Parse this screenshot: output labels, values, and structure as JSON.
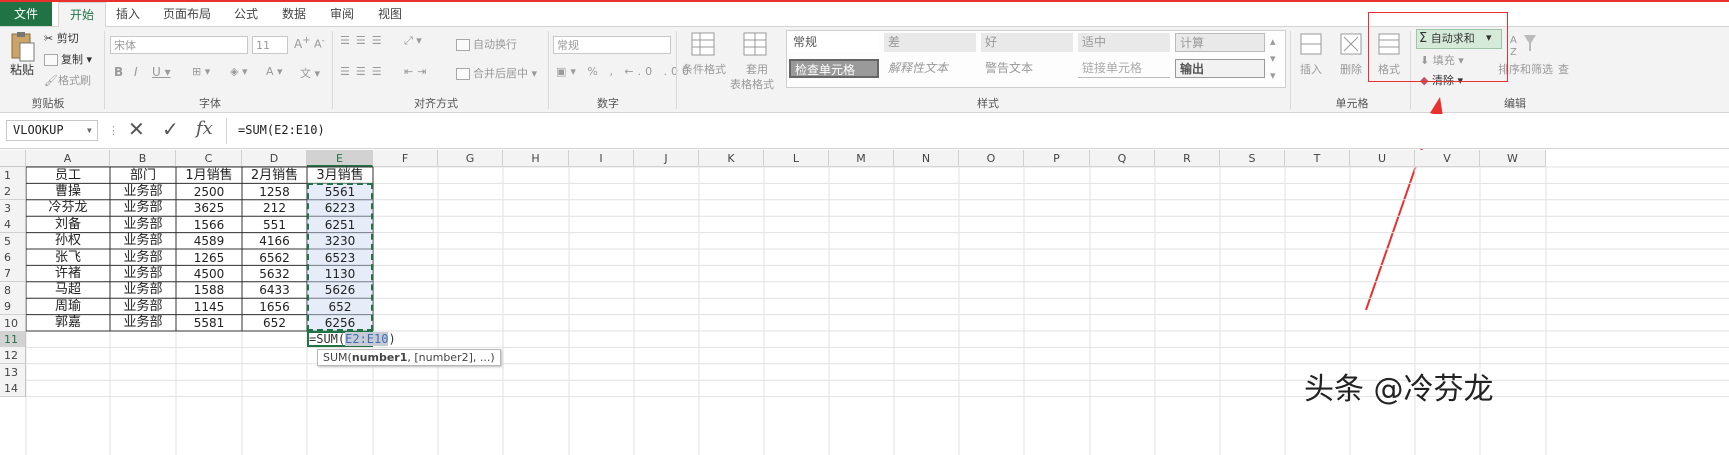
{
  "tabs": {
    "file": "文件",
    "home": "开始",
    "insert": "插入",
    "layout": "页面布局",
    "formulas": "公式",
    "data": "数据",
    "review": "审阅",
    "view": "视图"
  },
  "clipboard": {
    "paste": "粘贴",
    "cut": "剪切",
    "copy": "复制",
    "painter": "格式刷",
    "label": "剪贴板"
  },
  "font": {
    "name": "宋体",
    "size": "11",
    "label": "字体"
  },
  "align": {
    "wrap": "自动换行",
    "merge": "合并后居中",
    "label": "对齐方式"
  },
  "number": {
    "format": "常规",
    "label": "数字"
  },
  "styles": {
    "cond": "条件格式",
    "table1": "套用",
    "table2": "表格格式",
    "label": "样式",
    "cells": [
      "常规",
      "差",
      "好",
      "适中",
      "计算",
      "检查单元格",
      "解释性文本",
      "警告文本",
      "链接单元格",
      "输出"
    ]
  },
  "cells_group": {
    "insert": "插入",
    "delete": "删除",
    "format": "格式",
    "label": "单元格"
  },
  "editing": {
    "autosum": "自动求和",
    "fill": "填充",
    "clear": "清除",
    "sort": "排序和筛选",
    "find": "查",
    "label": "编辑"
  },
  "formula_bar": {
    "namebox": "VLOOKUP",
    "formula": "=SUM(E2:E10)"
  },
  "columns": [
    "A",
    "B",
    "C",
    "D",
    "E",
    "F",
    "G",
    "H",
    "I",
    "J",
    "K",
    "L",
    "M",
    "N",
    "O",
    "P",
    "Q",
    "R",
    "S",
    "T",
    "U",
    "V",
    "W"
  ],
  "rows": [
    "1",
    "2",
    "3",
    "4",
    "5",
    "6",
    "7",
    "8",
    "9",
    "10",
    "11",
    "12",
    "13",
    "14"
  ],
  "table": {
    "headers": [
      "员工",
      "部门",
      "1月销售",
      "2月销售",
      "3月销售"
    ],
    "data": [
      [
        "曹操",
        "业务部",
        "2500",
        "1258",
        "5561"
      ],
      [
        "冷芬龙",
        "业务部",
        "3625",
        "212",
        "6223"
      ],
      [
        "刘备",
        "业务部",
        "1566",
        "551",
        "6251"
      ],
      [
        "孙权",
        "业务部",
        "4589",
        "4166",
        "3230"
      ],
      [
        "张飞",
        "业务部",
        "1265",
        "6562",
        "6523"
      ],
      [
        "许褚",
        "业务部",
        "4500",
        "5632",
        "1130"
      ],
      [
        "马超",
        "业务部",
        "1588",
        "6433",
        "5626"
      ],
      [
        "周瑜",
        "业务部",
        "1145",
        "1656",
        "652"
      ],
      [
        "郭嘉",
        "业务部",
        "5581",
        "652",
        "6256"
      ]
    ]
  },
  "editing_cell": {
    "prefix": "=SUM(",
    "ref": "E2:E10",
    "suffix": ")"
  },
  "tooltip": {
    "fn": "SUM(",
    "arg1": "number1",
    "rest": ", [number2], ...)"
  },
  "watermark": "头条 @冷芬龙",
  "colors": {
    "excel_green": "#217346",
    "annotation_red": "#e8312f",
    "selection": "#217346"
  }
}
